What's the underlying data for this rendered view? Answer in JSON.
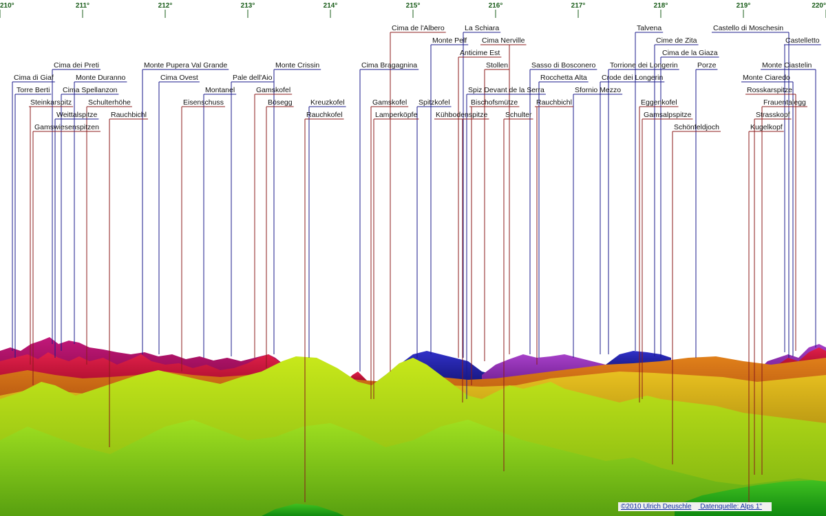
{
  "azimuth_ticks": [
    "210°",
    "211°",
    "212°",
    "213°",
    "214°",
    "215°",
    "216°",
    "217°",
    "218°",
    "219°",
    "220°"
  ],
  "peaks": [
    {
      "name": "Cima de l'Albero",
      "color": "#8b1a1a"
    },
    {
      "name": "La Schiara",
      "color": "#1a1a8b"
    },
    {
      "name": "Castello di Moschesin",
      "color": "#1a1a8b"
    },
    {
      "name": "Talvena",
      "color": "#1a1a8b"
    },
    {
      "name": "Monte Pelf",
      "color": "#1a1a8b"
    },
    {
      "name": "Cima Nerville",
      "color": "#8b1a1a"
    },
    {
      "name": "Cime de Zita",
      "color": "#1a1a8b"
    },
    {
      "name": "Castelletto",
      "color": "#1a1a8b"
    },
    {
      "name": "Anticime Est",
      "color": "#8b1a1a"
    },
    {
      "name": "Cima de la Giaza",
      "color": "#1a1a8b"
    },
    {
      "name": "Cima dei Preti",
      "color": "#1a1a8b"
    },
    {
      "name": "Monte Pupera Val Grande",
      "color": "#1a1a8b"
    },
    {
      "name": "Monte Crissin",
      "color": "#1a1a8b"
    },
    {
      "name": "Cima Bragagnina",
      "color": "#1a1a8b"
    },
    {
      "name": "Stollen",
      "color": "#8b1a1a"
    },
    {
      "name": "Sasso di Bosconero",
      "color": "#1a1a8b"
    },
    {
      "name": "Torrione dei Longerin",
      "color": "#1a1a8b"
    },
    {
      "name": "Porze",
      "color": "#1a1a8b"
    },
    {
      "name": "Monte Ciastelin",
      "color": "#1a1a8b"
    },
    {
      "name": "Cima di Giaf",
      "color": "#1a1a8b"
    },
    {
      "name": "Monte Duranno",
      "color": "#1a1a8b"
    },
    {
      "name": "Cima Ovest",
      "color": "#1a1a8b"
    },
    {
      "name": "Pale dell'Aio",
      "color": "#1a1a8b"
    },
    {
      "name": "Rocchetta Alta",
      "color": "#1a1a8b"
    },
    {
      "name": "Crode dei Longerin",
      "color": "#1a1a8b"
    },
    {
      "name": "Monte Ciaredo",
      "color": "#1a1a8b"
    },
    {
      "name": "Torre Berti",
      "color": "#1a1a8b"
    },
    {
      "name": "Cima Spellanzon",
      "color": "#1a1a8b"
    },
    {
      "name": "Montanel",
      "color": "#1a1a8b"
    },
    {
      "name": "Gamskofel",
      "color": "#8b1a1a"
    },
    {
      "name": "Spiz Devant de la Serra",
      "color": "#1a1a8b"
    },
    {
      "name": "Sfornio Mezzo",
      "color": "#1a1a8b"
    },
    {
      "name": "Rosskarspitze",
      "color": "#8b1a1a"
    },
    {
      "name": "Steinkarspitz",
      "color": "#8b1a1a"
    },
    {
      "name": "Schulterhöhe",
      "color": "#8b1a1a"
    },
    {
      "name": "Eisenschuss",
      "color": "#8b1a1a"
    },
    {
      "name": "Bösegg",
      "color": "#8b1a1a"
    },
    {
      "name": "Kreuzkofel",
      "color": "#1a1a8b"
    },
    {
      "name": "Gamskofel",
      "color": "#8b1a1a"
    },
    {
      "name": "Spitzkofel",
      "color": "#1a1a8b"
    },
    {
      "name": "Bischofsmütze",
      "color": "#8b1a1a"
    },
    {
      "name": "Rauchbichl",
      "color": "#8b1a1a"
    },
    {
      "name": "Eggenkofel",
      "color": "#8b1a1a"
    },
    {
      "name": "Frauentalegg",
      "color": "#8b1a1a"
    },
    {
      "name": "Weittalspitze",
      "color": "#1a1a8b"
    },
    {
      "name": "Rauchbichl",
      "color": "#8b1a1a"
    },
    {
      "name": "Rauchkofel",
      "color": "#8b1a1a"
    },
    {
      "name": "Lamperköpfe",
      "color": "#8b1a1a"
    },
    {
      "name": "Kühbodenspitze",
      "color": "#8b1a1a"
    },
    {
      "name": "Schulter",
      "color": "#8b1a1a"
    },
    {
      "name": "Gamsalpspitze",
      "color": "#8b1a1a"
    },
    {
      "name": "Strasskopf",
      "color": "#8b1a1a"
    },
    {
      "name": "Gamswiesenspitzen",
      "color": "#8b1a1a"
    },
    {
      "name": "Schönfeldjoch",
      "color": "#8b1a1a"
    },
    {
      "name": "Kugelkopf",
      "color": "#8b1a1a"
    }
  ],
  "credit": {
    "author": "©2010 Ulrich Deuschle",
    "source": "Datenquelle: Alps 1\""
  }
}
